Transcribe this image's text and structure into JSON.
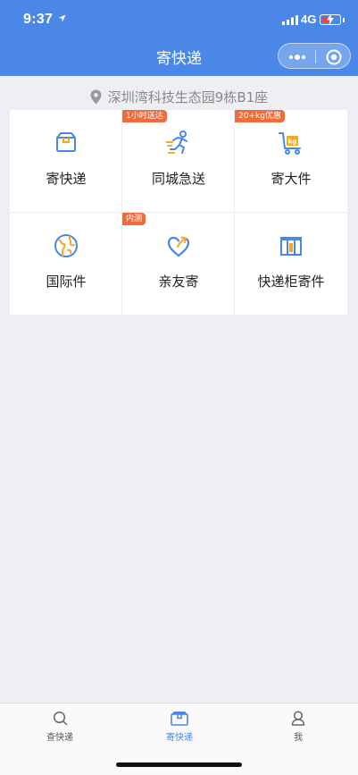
{
  "status_bar": {
    "time": "9:37",
    "network": "4G"
  },
  "nav": {
    "title": "寄快递"
  },
  "location": {
    "address": "深圳湾科技生态园9栋B1座"
  },
  "services": [
    {
      "label": "寄快递",
      "icon": "box-icon",
      "badge": ""
    },
    {
      "label": "同城急送",
      "icon": "running-person-icon",
      "badge": "1小时送达"
    },
    {
      "label": "寄大件",
      "icon": "cart-kg-icon",
      "badge": "20+kg优惠"
    },
    {
      "label": "国际件",
      "icon": "globe-icon",
      "badge": ""
    },
    {
      "label": "亲友寄",
      "icon": "heart-arrow-icon",
      "badge": "内测"
    },
    {
      "label": "快递柜寄件",
      "icon": "locker-icon",
      "badge": ""
    }
  ],
  "tabbar": [
    {
      "label": "查快递",
      "icon": "search-icon",
      "active": false
    },
    {
      "label": "寄快递",
      "icon": "package-icon",
      "active": true
    },
    {
      "label": "我",
      "icon": "person-icon",
      "active": false
    }
  ],
  "colors": {
    "primary": "#4a87e6",
    "badge": "#ef6b3a",
    "icon_accent": "#f5a623"
  }
}
